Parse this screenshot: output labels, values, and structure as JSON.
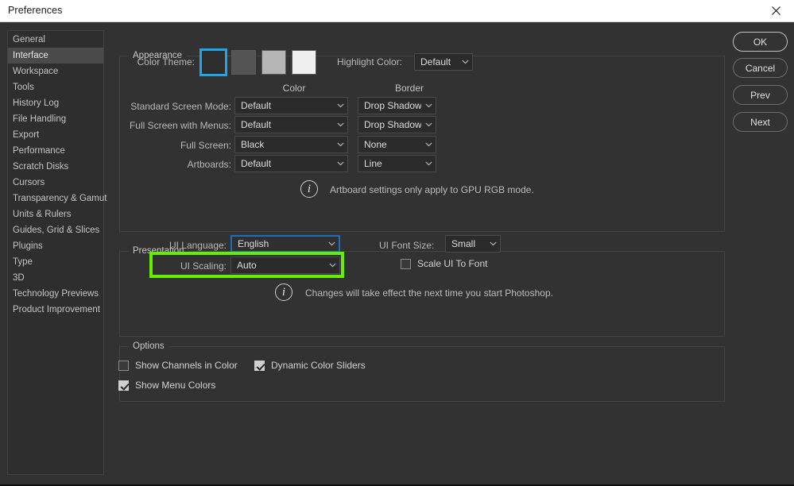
{
  "window": {
    "title": "Preferences",
    "close_icon": "close-icon"
  },
  "sidebar": {
    "items": [
      {
        "label": "General",
        "selected": false
      },
      {
        "label": "Interface",
        "selected": true
      },
      {
        "label": "Workspace",
        "selected": false
      },
      {
        "label": "Tools",
        "selected": false
      },
      {
        "label": "History Log",
        "selected": false
      },
      {
        "label": "File Handling",
        "selected": false
      },
      {
        "label": "Export",
        "selected": false
      },
      {
        "label": "Performance",
        "selected": false
      },
      {
        "label": "Scratch Disks",
        "selected": false
      },
      {
        "label": "Cursors",
        "selected": false
      },
      {
        "label": "Transparency & Gamut",
        "selected": false
      },
      {
        "label": "Units & Rulers",
        "selected": false
      },
      {
        "label": "Guides, Grid & Slices",
        "selected": false
      },
      {
        "label": "Plugins",
        "selected": false
      },
      {
        "label": "Type",
        "selected": false
      },
      {
        "label": "3D",
        "selected": false
      },
      {
        "label": "Technology Previews",
        "selected": false
      },
      {
        "label": "Product Improvement",
        "selected": false
      }
    ]
  },
  "appearance": {
    "title": "Appearance",
    "color_theme_label": "Color Theme:",
    "swatches": [
      {
        "name": "theme-dark",
        "color": "#2d2d2d",
        "selected": true
      },
      {
        "name": "theme-medium-dark",
        "color": "#545454",
        "selected": false
      },
      {
        "name": "theme-light-gray",
        "color": "#b5b5b5",
        "selected": false
      },
      {
        "name": "theme-white",
        "color": "#f0f0f0",
        "selected": false
      }
    ],
    "highlight_color_label": "Highlight Color:",
    "highlight_color_value": "Default",
    "col_header_color": "Color",
    "col_header_border": "Border",
    "rows": [
      {
        "label": "Standard Screen Mode:",
        "color": "Default",
        "border": "Drop Shadow"
      },
      {
        "label": "Full Screen with Menus:",
        "color": "Default",
        "border": "Drop Shadow"
      },
      {
        "label": "Full Screen:",
        "color": "Black",
        "border": "None"
      },
      {
        "label": "Artboards:",
        "color": "Default",
        "border": "Line"
      }
    ],
    "info_text": "Artboard settings only apply to GPU RGB mode.",
    "info_icon": "info-icon"
  },
  "presentation": {
    "title": "Presentation",
    "ui_language_label": "UI Language:",
    "ui_language_value": "English",
    "ui_scaling_label": "UI Scaling:",
    "ui_scaling_value": "Auto",
    "ui_font_size_label": "UI Font Size:",
    "ui_font_size_value": "Small",
    "scale_ui_to_font_label": "Scale UI To Font",
    "scale_ui_to_font_checked": false,
    "info_text": "Changes will take effect the next time you start Photoshop.",
    "info_icon": "info-icon"
  },
  "options": {
    "title": "Options",
    "checkboxes": [
      {
        "label": "Show Channels in Color",
        "checked": false
      },
      {
        "label": "Dynamic Color Sliders",
        "checked": true
      },
      {
        "label": "Show Menu Colors",
        "checked": true
      }
    ]
  },
  "buttons": [
    {
      "label": "OK",
      "primary": true
    },
    {
      "label": "Cancel",
      "primary": false
    },
    {
      "label": "Prev",
      "primary": false
    },
    {
      "label": "Next",
      "primary": false
    }
  ],
  "annotation": {
    "highlight_color": "#66ee00",
    "target": "ui-language-row"
  }
}
